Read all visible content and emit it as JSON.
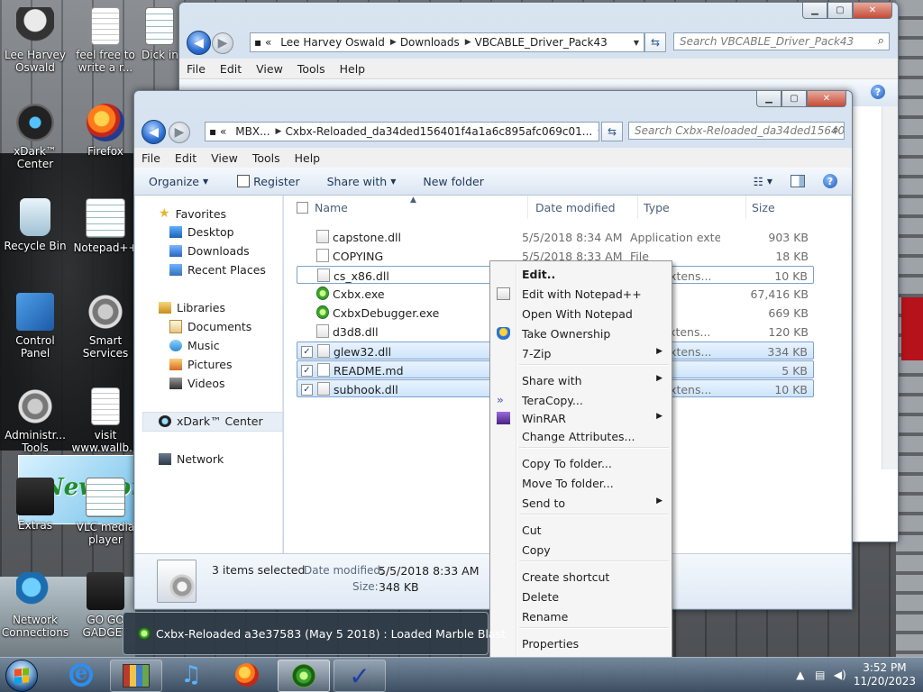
{
  "desktop": {
    "icons": [
      {
        "label": "Lee Harvey Oswald"
      },
      {
        "label": "feel free to write a r..."
      },
      {
        "label": "Dick in"
      },
      {
        "label": "xDark™ Center"
      },
      {
        "label": "Firefox"
      },
      {
        "label": "Recycle Bin"
      },
      {
        "label": "Notepad++"
      },
      {
        "label": "Control Panel"
      },
      {
        "label": "Smart Services"
      },
      {
        "label": "Administr... Tools"
      },
      {
        "label": "visit www.wallb..."
      },
      {
        "label": "Extras"
      },
      {
        "label": "VLC media player"
      },
      {
        "label": "Network Connections"
      },
      {
        "label": "GO GO GADGET"
      }
    ],
    "wallpaper_text": "Newport"
  },
  "back_window": {
    "breadcrumb": [
      "Lee Harvey Oswald",
      "Downloads",
      "VBCABLE_Driver_Pack43"
    ],
    "search_placeholder": "Search VBCABLE_Driver_Pack43",
    "menu": [
      "File",
      "Edit",
      "View",
      "Tools",
      "Help"
    ]
  },
  "explorer": {
    "breadcrumb": [
      "MBX...",
      "Cxbx-Reloaded_da34ded156401f4a1a6c895afc069c01..."
    ],
    "search_placeholder": "Search Cxbx-Reloaded_da34ded15640...",
    "menu": [
      "File",
      "Edit",
      "View",
      "Tools",
      "Help"
    ],
    "toolbar": {
      "organize": "Organize",
      "register": "Register",
      "share_with": "Share with",
      "new_folder": "New folder"
    },
    "nav": {
      "favorites": "Favorites",
      "desktop": "Desktop",
      "downloads": "Downloads",
      "recent": "Recent Places",
      "libraries": "Libraries",
      "documents": "Documents",
      "music": "Music",
      "pictures": "Pictures",
      "videos": "Videos",
      "xdark": "xDark™ Center",
      "network": "Network"
    },
    "columns": {
      "name": "Name",
      "date": "Date modified",
      "type": "Type",
      "size": "Size"
    },
    "files": [
      {
        "name": "capstone.dll",
        "date": "5/5/2018 8:34 AM",
        "type": "Application extens...",
        "size": "903 KB",
        "kind": "dll",
        "selected": false
      },
      {
        "name": "COPYING",
        "date": "5/5/2018 8:33 AM",
        "type": "File",
        "size": "18 KB",
        "kind": "file",
        "selected": false
      },
      {
        "name": "cs_x86.dll",
        "date": "",
        "type": "ation extens...",
        "size": "10 KB",
        "kind": "dll",
        "selected": false
      },
      {
        "name": "Cxbx.exe",
        "date": "",
        "type": "ation",
        "size": "67,416 KB",
        "kind": "exe",
        "selected": false
      },
      {
        "name": "CxbxDebugger.exe",
        "date": "",
        "type": "ation",
        "size": "669 KB",
        "kind": "exe",
        "selected": false
      },
      {
        "name": "d3d8.dll",
        "date": "",
        "type": "ation extens...",
        "size": "120 KB",
        "kind": "dll",
        "selected": false
      },
      {
        "name": "glew32.dll",
        "date": "",
        "type": "ation extens...",
        "size": "334 KB",
        "kind": "dll",
        "selected": true
      },
      {
        "name": "README.md",
        "date": "",
        "type": "e",
        "size": "5 KB",
        "kind": "md",
        "selected": true
      },
      {
        "name": "subhook.dll",
        "date": "",
        "type": "ation extens...",
        "size": "10 KB",
        "kind": "dll",
        "selected": true
      }
    ],
    "details": {
      "count": "3 items selected",
      "date_label": "Date modified:",
      "date_value": "5/5/2018 8:33 AM",
      "size_label": "Size:",
      "size_value": "348 KB"
    }
  },
  "context_menu": {
    "items": [
      {
        "label": "Edit..",
        "bold": true
      },
      {
        "label": "Edit with Notepad++",
        "icon": "notepadpp-icon"
      },
      {
        "label": "Open With Notepad"
      },
      {
        "label": "Take Ownership",
        "icon": "uac-shield-icon"
      },
      {
        "label": "7-Zip",
        "submenu": true
      },
      {
        "label": "Share with",
        "submenu": true
      },
      {
        "label": "TeraCopy...",
        "icon": "teracopy-icon"
      },
      {
        "label": "WinRAR",
        "submenu": true,
        "icon": "winrar-icon"
      },
      {
        "label": "Change Attributes..."
      },
      {
        "label": "Copy To folder..."
      },
      {
        "label": "Move To folder..."
      },
      {
        "label": "Send to",
        "submenu": true
      },
      {
        "label": "Cut"
      },
      {
        "label": "Copy"
      },
      {
        "label": "Create shortcut"
      },
      {
        "label": "Delete"
      },
      {
        "label": "Rename"
      },
      {
        "label": "Properties"
      }
    ]
  },
  "taskbar": {
    "thumbnail_title": "Cxbx-Reloaded a3e37583 (May  5 2018) : Loaded Marble Blast",
    "clock_time": "3:52 PM",
    "clock_date": "11/20/2023"
  }
}
